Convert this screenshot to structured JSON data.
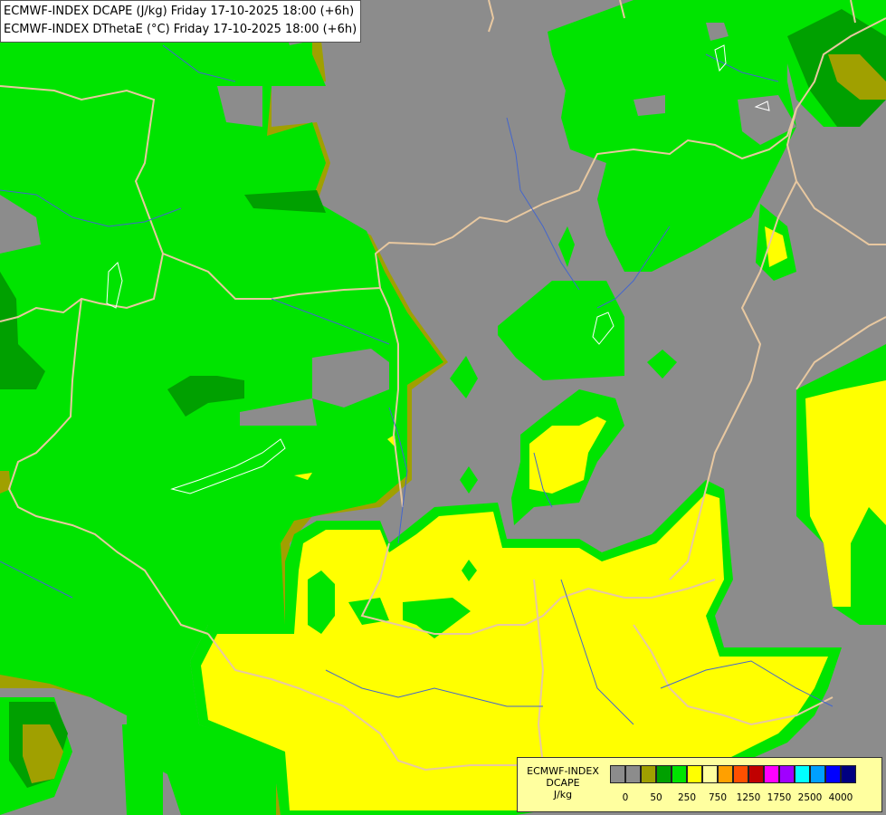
{
  "header": {
    "line1": "ECMWF-INDEX DCAPE (J/kg) Friday 17-10-2025 18:00 (+6h)",
    "line2": "ECMWF-INDEX DThetaE (°C) Friday 17-10-2025 18:00 (+6h)"
  },
  "map": {
    "colors": {
      "background": "#8c8c8c",
      "green": "#00e400",
      "dark_green": "#00a000",
      "olive": "#a0a000",
      "yellow": "#ffff00",
      "border_line": "#e8c8a0",
      "river_line": "#4466cc"
    }
  },
  "legend": {
    "label_lines": [
      "ECMWF-INDEX",
      "DCAPE",
      "J/kg"
    ],
    "swatch_colors": [
      "#8c8c8c",
      "#8c8c8c",
      "#a0a000",
      "#00a000",
      "#00e400",
      "#ffff00",
      "#ffff9f",
      "#ffa000",
      "#ff5000",
      "#c00000",
      "#ff00ff",
      "#a000ff",
      "#00ffff",
      "#00a0ff",
      "#0000ff",
      "#000080"
    ],
    "ticks": [
      "0",
      "50",
      "250",
      "750",
      "1250",
      "1750",
      "2500",
      "4000"
    ]
  }
}
